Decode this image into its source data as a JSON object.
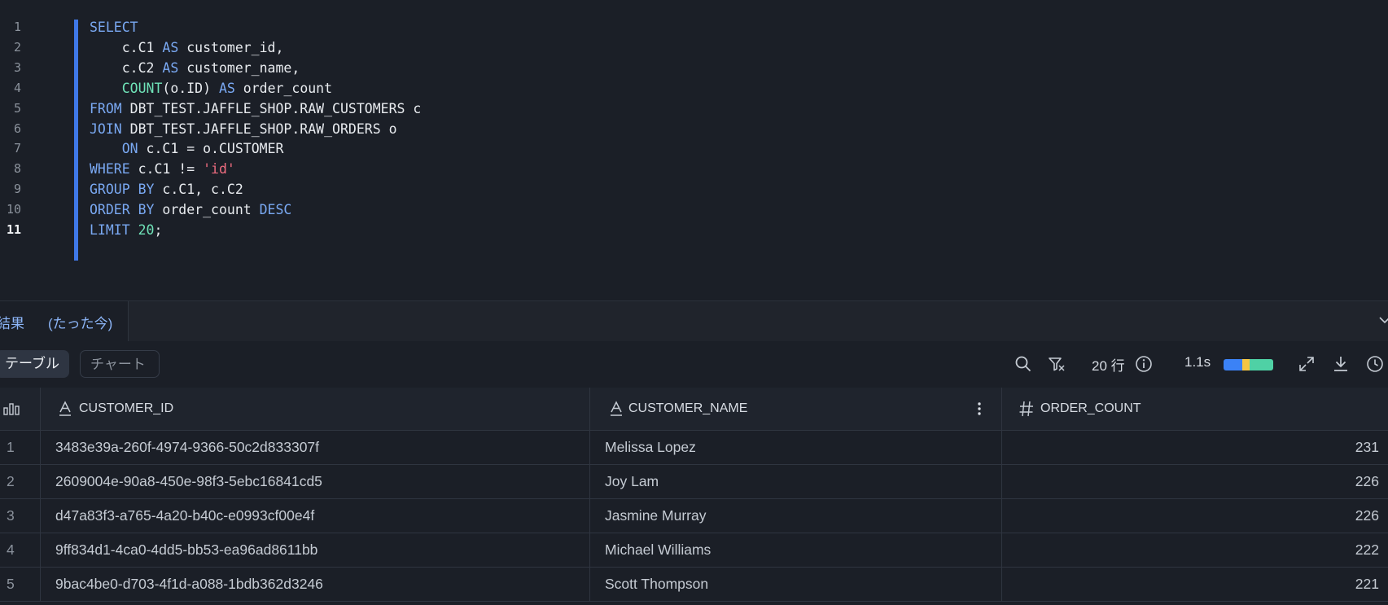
{
  "editor": {
    "lines": [
      {
        "n": "1",
        "code": "SELECT"
      },
      {
        "n": "2",
        "code": "    c.C1 AS customer_id,"
      },
      {
        "n": "3",
        "code": "    c.C2 AS customer_name,"
      },
      {
        "n": "4",
        "code": "    COUNT(o.ID) AS order_count"
      },
      {
        "n": "5",
        "code": "FROM DBT_TEST.JAFFLE_SHOP.RAW_CUSTOMERS c"
      },
      {
        "n": "6",
        "code": "JOIN DBT_TEST.JAFFLE_SHOP.RAW_ORDERS o"
      },
      {
        "n": "7",
        "code": "    ON c.C1 = o.CUSTOMER"
      },
      {
        "n": "8",
        "code": "WHERE c.C1 != 'id'"
      },
      {
        "n": "9",
        "code": "GROUP BY c.C1, c.C2"
      },
      {
        "n": "10",
        "code": "ORDER BY order_count DESC"
      },
      {
        "n": "11",
        "code": "LIMIT 20;"
      }
    ],
    "active_line": "11",
    "keyword_color": "#7aa9f3",
    "function_color": "#6fe3b8",
    "string_color": "#f06d80"
  },
  "results_tab": {
    "title": "結果",
    "time": "(たった今)",
    "collapse_icon": "chevron-down-icon"
  },
  "toolbar": {
    "table_label": "テーブル",
    "chart_label": "チャート",
    "search_icon": "search-icon",
    "filter_icon": "filter-icon",
    "rows_label": "20 行",
    "info_icon": "info-icon",
    "elapsed": "1.1s",
    "timing_colors": [
      "#3b82f6",
      "#f5c542",
      "#4fd1a5"
    ],
    "expand_icon": "expand-icon",
    "download_icon": "download-icon",
    "history_icon": "clock-icon"
  },
  "grid": {
    "row_index_icon": "column-stats-icon",
    "columns": [
      {
        "name": "CUSTOMER_ID",
        "type_icon": "text-type-icon"
      },
      {
        "name": "CUSTOMER_NAME",
        "type_icon": "text-type-icon",
        "menu_icon": "kebab-menu-icon"
      },
      {
        "name": "ORDER_COUNT",
        "type_icon": "number-type-icon"
      }
    ],
    "rows": [
      {
        "idx": "1",
        "customer_id": "3483e39a-260f-4974-9366-50c2d833307f",
        "customer_name": "Melissa Lopez",
        "order_count": "231"
      },
      {
        "idx": "2",
        "customer_id": "2609004e-90a8-450e-98f3-5ebc16841cd5",
        "customer_name": "Joy Lam",
        "order_count": "226"
      },
      {
        "idx": "3",
        "customer_id": "d47a83f3-a765-4a20-b40c-e0993cf00e4f",
        "customer_name": "Jasmine Murray",
        "order_count": "226"
      },
      {
        "idx": "4",
        "customer_id": "9ff834d1-4ca0-4dd5-bb53-ea96ad8611bb",
        "customer_name": "Michael Williams",
        "order_count": "222"
      },
      {
        "idx": "5",
        "customer_id": "9bac4be0-d703-4f1d-a088-1bdb362d3246",
        "customer_name": "Scott Thompson",
        "order_count": "221"
      }
    ]
  }
}
